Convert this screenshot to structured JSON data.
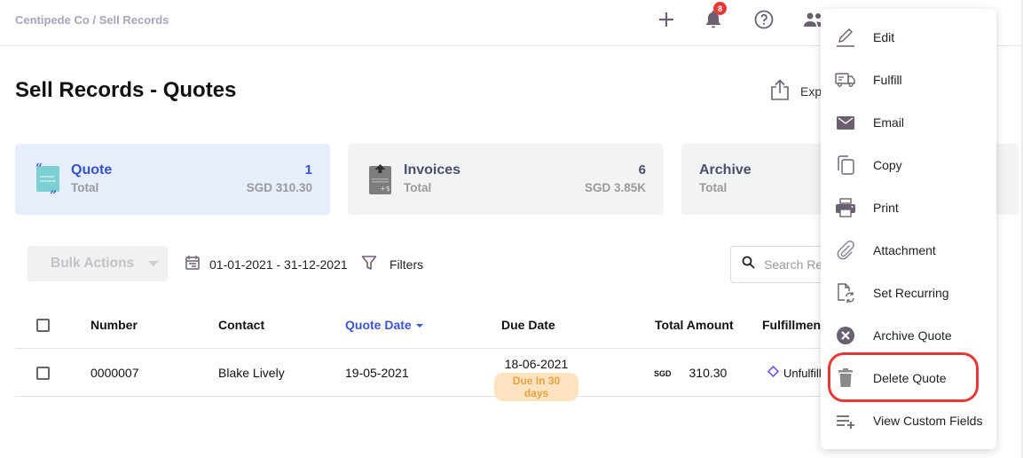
{
  "header": {
    "breadcrumb": "Centipede Co / Sell Records",
    "notification_count": "8",
    "icons": [
      "plus-icon",
      "bell-icon",
      "help-icon",
      "users-icon"
    ]
  },
  "page": {
    "title": "Sell Records - Quotes",
    "export_label": "Exp"
  },
  "summary_cards": [
    {
      "label": "Quote",
      "sub": "Total",
      "count": "1",
      "amount": "SGD 310.30",
      "active": true
    },
    {
      "label": "Invoices",
      "sub": "Total",
      "count": "6",
      "amount": "SGD 3.85K",
      "active": false
    },
    {
      "label": "Archive",
      "sub": "Total",
      "count": "",
      "amount": "",
      "active": false
    }
  ],
  "toolbar": {
    "bulk_actions": "Bulk Actions",
    "date_range": "01-01-2021 - 31-12-2021",
    "filters": "Filters",
    "search_placeholder": "Search Records"
  },
  "table": {
    "columns": [
      "Number",
      "Contact",
      "Quote Date",
      "Due Date",
      "Total Amount",
      "Fulfillment"
    ],
    "sorted_column": "Quote Date",
    "rows": [
      {
        "number": "0000007",
        "contact": "Blake Lively",
        "quote_date": "19-05-2021",
        "due_date": "18-06-2021",
        "due_badge": "Due In 30 days",
        "currency": "SGD",
        "amount": "310.30",
        "fulfillment": "Unfulfilled"
      }
    ]
  },
  "context_menu": {
    "items": [
      {
        "label": "Edit",
        "icon": "pencil-icon"
      },
      {
        "label": "Fulfill",
        "icon": "truck-icon"
      },
      {
        "label": "Email",
        "icon": "envelope-icon"
      },
      {
        "label": "Copy",
        "icon": "copy-icon"
      },
      {
        "label": "Print",
        "icon": "printer-icon"
      },
      {
        "label": "Attachment",
        "icon": "paperclip-icon"
      },
      {
        "label": "Set Recurring",
        "icon": "recurring-document-icon"
      },
      {
        "label": "Archive Quote",
        "icon": "archive-x-icon"
      },
      {
        "label": "Delete Quote",
        "icon": "trash-icon"
      },
      {
        "label": "View Custom Fields",
        "icon": "list-add-icon"
      }
    ],
    "highlighted_item": "Delete Quote"
  },
  "colors": {
    "accent": "#3b55d6",
    "highlight_ring": "#e53935",
    "badge": "#e53935",
    "due_pill_bg": "#fde3c0",
    "due_pill_text": "#eba13f",
    "icon": "#6b6070"
  }
}
